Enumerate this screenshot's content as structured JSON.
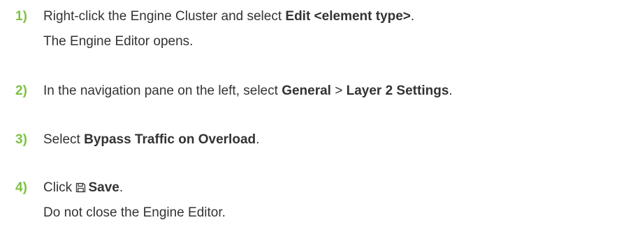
{
  "accent_color": "#7cc242",
  "steps": [
    {
      "number": "1)",
      "pre": "Right-click the Engine Cluster and select ",
      "bold": "Edit <element type>",
      "post": ".",
      "result": "The Engine Editor opens."
    },
    {
      "number": "2)",
      "pre": "In the navigation pane on the left, select ",
      "bold1": "General",
      "sep": " > ",
      "bold2": "Layer 2 Settings",
      "post": "."
    },
    {
      "number": "3)",
      "pre": "Select ",
      "bold": "Bypass Traffic on Overload",
      "post": "."
    },
    {
      "number": "4)",
      "pre": "Click ",
      "icon": "save-icon",
      "bold": "Save",
      "post": ".",
      "result": "Do not close the Engine Editor."
    }
  ]
}
